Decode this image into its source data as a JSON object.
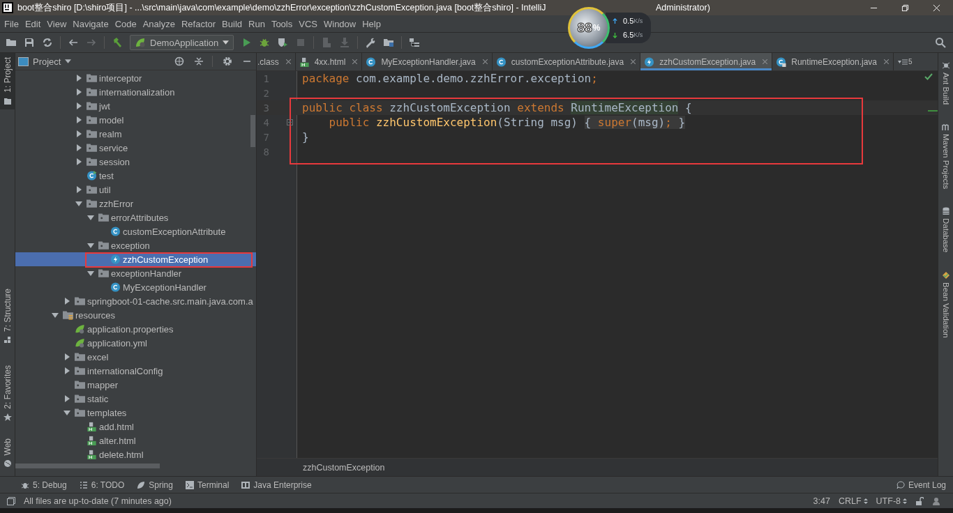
{
  "window": {
    "title": "boot整合shiro [D:\\shiro项目] - ...\\src\\main\\java\\com\\example\\demo\\zzhError\\exception\\zzhCustomException.java [boot整合shiro] - IntelliJ",
    "title_tail": "Administrator)"
  },
  "speed_widget": {
    "percent": "88",
    "percent_sign": "%",
    "upload": "0.5",
    "upload_unit": "K/s",
    "download": "6.5",
    "download_unit": "K/s"
  },
  "menu": [
    "File",
    "Edit",
    "View",
    "Navigate",
    "Code",
    "Analyze",
    "Refactor",
    "Build",
    "Run",
    "Tools",
    "VCS",
    "Window",
    "Help"
  ],
  "toolbar": {
    "run_config": "DemoApplication"
  },
  "left_strip": [
    {
      "label": "1: Project",
      "selected": true
    },
    {
      "label": "7: Structure",
      "selected": false
    },
    {
      "label": "2: Favorites",
      "selected": false
    },
    {
      "label": "Web",
      "selected": false
    }
  ],
  "project_panel": {
    "title": "Project"
  },
  "tree": [
    {
      "children": [
        {
          "children": [
            {
              "label": "interceptor",
              "kind": "package",
              "expanded": false,
              "selected": false
            },
            {
              "label": "internationalization",
              "kind": "package",
              "expanded": false,
              "selected": false
            },
            {
              "label": "jwt",
              "kind": "package",
              "expanded": false,
              "selected": false
            },
            {
              "label": "model",
              "kind": "package",
              "expanded": false,
              "selected": false
            },
            {
              "label": "realm",
              "kind": "package",
              "expanded": false,
              "selected": false
            },
            {
              "label": "service",
              "kind": "package",
              "expanded": false,
              "selected": false
            },
            {
              "label": "session",
              "kind": "package",
              "expanded": false,
              "selected": false
            },
            {
              "label": "test",
              "kind": "runnable-class",
              "selected": false
            },
            {
              "label": "util",
              "kind": "package",
              "expanded": false,
              "selected": false
            },
            {
              "label": "zzhError",
              "kind": "package",
              "expanded": true,
              "selected": false,
              "children": [
                {
                  "label": "errorAttributes",
                  "kind": "package",
                  "expanded": true,
                  "selected": false,
                  "children": [
                    {
                      "label": "customExceptionAttribute",
                      "kind": "class",
                      "selected": false
                    }
                  ]
                },
                {
                  "label": "exception",
                  "kind": "package",
                  "expanded": true,
                  "selected": false,
                  "children": [
                    {
                      "label": "zzhCustomException",
                      "kind": "exception",
                      "selected": true,
                      "boxed": true
                    }
                  ]
                },
                {
                  "label": "exceptionHandler",
                  "kind": "package",
                  "expanded": true,
                  "selected": false,
                  "children": [
                    {
                      "label": "MyExceptionHandler",
                      "kind": "class",
                      "selected": false
                    }
                  ]
                }
              ]
            }
          ]
        },
        {
          "label": "springboot-01-cache.src.main.java.com.a",
          "kind": "package",
          "expanded": false,
          "selected": false
        }
      ]
    },
    {
      "label": "resources",
      "kind": "resources",
      "expanded": true,
      "selected": false,
      "children": [
        {
          "label": "application.properties",
          "kind": "spring",
          "selected": false
        },
        {
          "label": "application.yml",
          "kind": "spring",
          "selected": false
        },
        {
          "label": "excel",
          "kind": "folder",
          "expanded": false,
          "selected": false
        },
        {
          "label": "internationalConfig",
          "kind": "folder",
          "expanded": false,
          "selected": false
        },
        {
          "label": "mapper",
          "kind": "folder",
          "selected": false
        },
        {
          "label": "static",
          "kind": "folder",
          "expanded": false,
          "selected": false
        },
        {
          "label": "templates",
          "kind": "folder",
          "expanded": true,
          "selected": false,
          "children": [
            {
              "label": "add.html",
              "kind": "html",
              "selected": false
            },
            {
              "label": "alter.html",
              "kind": "html",
              "selected": false
            },
            {
              "label": "delete.html",
              "kind": "html",
              "selected": false
            }
          ]
        }
      ]
    }
  ],
  "tabs": [
    {
      "label": ".class",
      "kind": "none",
      "selected": false
    },
    {
      "label": "4xx.html",
      "kind": "html",
      "selected": false
    },
    {
      "label": "MyExceptionHandler.java",
      "kind": "class",
      "selected": false
    },
    {
      "label": "customExceptionAttribute.java",
      "kind": "class",
      "selected": false
    },
    {
      "label": "zzhCustomException.java",
      "kind": "exception",
      "selected": true
    },
    {
      "label": "RuntimeException.java",
      "kind": "locked-class",
      "selected": false
    }
  ],
  "tab_overflow": "5",
  "code": [
    {
      "number": "1",
      "current": false,
      "boxed": false,
      "fold": false,
      "tokens": [
        {
          "text": "package ",
          "kind": "keyword"
        },
        {
          "text": "com.example.demo.zzhError.exception",
          "kind": "plain"
        },
        {
          "text": ";",
          "kind": "keyword"
        }
      ]
    },
    {
      "number": "2",
      "current": false,
      "boxed": false,
      "fold": false
    },
    {
      "number": "3",
      "current": true,
      "boxed": true,
      "fold": false,
      "tokens": [
        {
          "text": "public class ",
          "kind": "keyword"
        },
        {
          "text": "zzhCustomException ",
          "kind": "plain"
        },
        {
          "text": "extends ",
          "kind": "keyword"
        },
        {
          "text": "RuntimeException",
          "kind": "usage"
        },
        {
          "text": " {",
          "kind": "plain"
        }
      ]
    },
    {
      "number": "4",
      "current": false,
      "boxed": true,
      "fold": true,
      "tokens": [
        {
          "text": "    public ",
          "kind": "keyword"
        },
        {
          "text": "zzhCustomException",
          "kind": "method"
        },
        {
          "text": "(String msg) ",
          "kind": "plain"
        },
        {
          "text": "{ ",
          "kind": "folded"
        },
        {
          "text": "super",
          "kind": "folded-keyword"
        },
        {
          "text": "(msg)",
          "kind": "folded"
        },
        {
          "text": ";",
          "kind": "folded-keyword"
        },
        {
          "text": " }",
          "kind": "folded"
        }
      ]
    },
    {
      "number": "7",
      "current": false,
      "boxed": true,
      "fold": false,
      "tokens": [
        {
          "text": "}",
          "kind": "plain"
        }
      ]
    },
    {
      "number": "8",
      "current": false,
      "boxed": true,
      "fold": false
    }
  ],
  "breadcrumb": "zzhCustomException",
  "right_strip": [
    "Ant Build",
    "Maven Projects",
    "Database",
    "Bean Validation"
  ],
  "tool_windows": [
    {
      "label": "5: Debug",
      "kind": "bug"
    },
    {
      "label": "6: TODO",
      "kind": "list"
    },
    {
      "label": "Spring",
      "kind": "leaf"
    },
    {
      "label": "Terminal",
      "kind": "terminal"
    },
    {
      "label": "Java Enterprise",
      "kind": "ee"
    }
  ],
  "event_log": "Event Log",
  "status": {
    "message": "All files are up-to-date (7 minutes ago)",
    "position": "3:47",
    "line_separator": "CRLF",
    "encoding": "UTF-8"
  }
}
